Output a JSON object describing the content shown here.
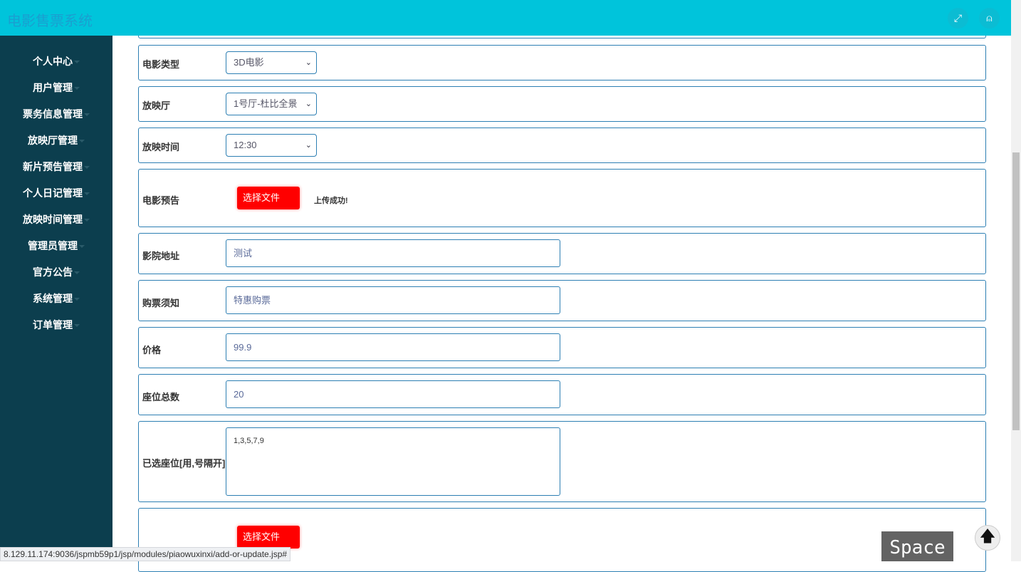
{
  "header": {
    "title": "电影售票系统",
    "fullscreen_icon": "expand-icon",
    "user_icon": "user-icon"
  },
  "sidebar": {
    "items": [
      {
        "label": "个人中心"
      },
      {
        "label": "用户管理"
      },
      {
        "label": "票务信息管理"
      },
      {
        "label": "放映厅管理"
      },
      {
        "label": "新片预告管理"
      },
      {
        "label": "个人日记管理"
      },
      {
        "label": "放映时间管理"
      },
      {
        "label": "管理员管理"
      },
      {
        "label": "官方公告"
      },
      {
        "label": "系统管理"
      },
      {
        "label": "订单管理"
      }
    ]
  },
  "form": {
    "movie_type": {
      "label": "电影类型",
      "value": "3D电影"
    },
    "hall": {
      "label": "放映厅",
      "value": "1号厅-杜比全景"
    },
    "time": {
      "label": "放映时间",
      "value": "12:30"
    },
    "trailer": {
      "label": "电影预告",
      "button": "选择文件",
      "status": "上传成功!"
    },
    "address": {
      "label": "影院地址",
      "value": "测试"
    },
    "notice": {
      "label": "购票须知",
      "value": "特惠购票"
    },
    "price": {
      "label": "价格",
      "value": "99.9"
    },
    "seats_total": {
      "label": "座位总数",
      "value": "20"
    },
    "seats_selected": {
      "label": "已选座位[用,号隔开]",
      "value": "1,3,5,7,9"
    },
    "file2": {
      "button": "选择文件"
    }
  },
  "status_bar": "8.129.11.174:9036/jspmb59p1/jsp/modules/piaowuxinxi/add-or-update.jsp#",
  "overlay_key": "Space"
}
